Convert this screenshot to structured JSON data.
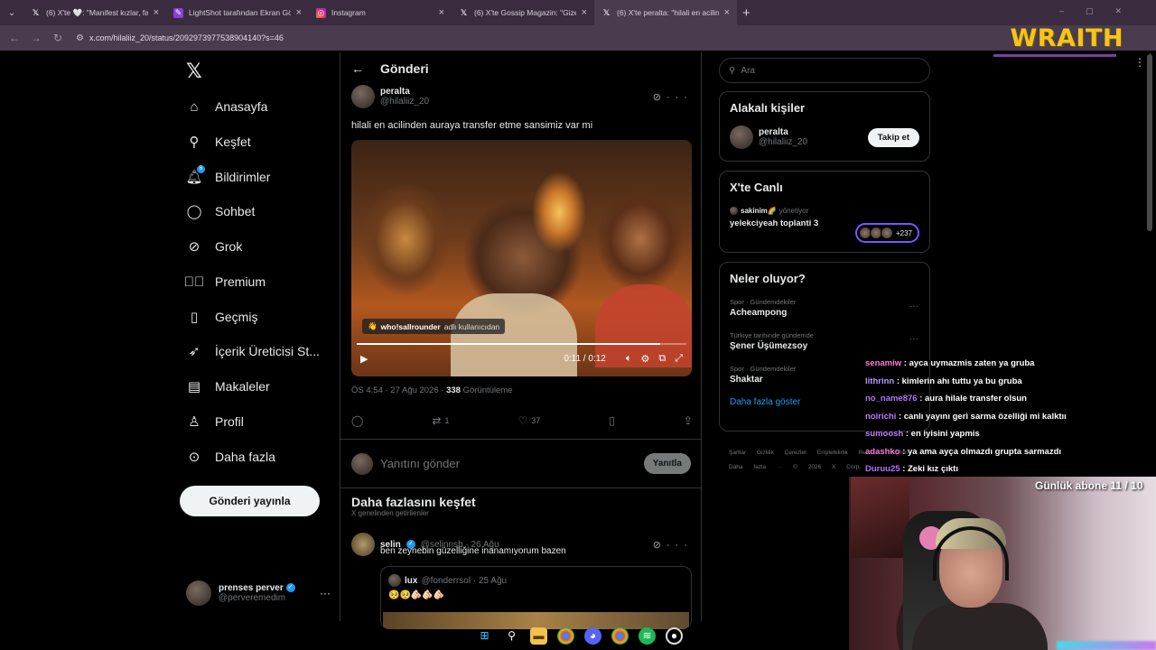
{
  "browser": {
    "tabs": [
      {
        "title": "(6) X'te 🤍: \"Manifest kızlar, fan",
        "favicon": "x-icon",
        "active": false
      },
      {
        "title": "LightShot tarafından Ekran Gör",
        "favicon": "lightshot-icon",
        "active": false
      },
      {
        "title": "Instagram",
        "favicon": "instagram-icon",
        "active": false
      },
      {
        "title": "(6) X'te Gossip Magazin: \"Gizem",
        "favicon": "x-icon",
        "active": false
      },
      {
        "title": "(6) X'te peralta: \"hilali en acilind",
        "favicon": "x-icon",
        "active": true
      }
    ],
    "url": "x.com/hilaliiz_20/status/2092973977538904140?s=46"
  },
  "overlay_brand": "WRAITH",
  "nav": {
    "items": [
      {
        "label": "Anasayfa",
        "icon": "home-icon"
      },
      {
        "label": "Keşfet",
        "icon": "search-icon"
      },
      {
        "label": "Bildirimler",
        "icon": "bell-icon",
        "badge": "6"
      },
      {
        "label": "Sohbet",
        "icon": "chat-icon"
      },
      {
        "label": "Grok",
        "icon": "grok-icon"
      },
      {
        "label": "Premium",
        "icon": "premium-icon"
      },
      {
        "label": "Geçmiş",
        "icon": "bookmark-icon"
      },
      {
        "label": "İçerik Üreticisi St...",
        "icon": "rocket-icon"
      },
      {
        "label": "Makaleler",
        "icon": "article-icon"
      },
      {
        "label": "Profil",
        "icon": "person-icon"
      },
      {
        "label": "Daha fazla",
        "icon": "more-icon"
      }
    ],
    "post_button": "Gönderi yayınla",
    "me": {
      "name": "prenses perver",
      "handle": "@perveremedim"
    }
  },
  "main": {
    "header": "Gönderi",
    "tweet": {
      "name": "peralta",
      "handle": "@hilaliiz_20",
      "text": "hilali en acilinden auraya transfer etme sansimiz var mi",
      "video_caption_user": "who!sallrounder",
      "video_caption_sub": "adlı kullanıcıdan",
      "video_time": "0:11 / 0:12",
      "video_progress": 0.92,
      "timestamp": "ÖS 4:54 · 27 Ağu 2026 · ",
      "views": "338",
      "views_label": "Görüntüleme",
      "retweets": "1",
      "likes": "37"
    },
    "reply_placeholder": "Yanıtını gönder",
    "reply_button": "Yanıtla",
    "discover_title": "Daha fazlasını keşfet",
    "discover_sub": "X genelinden getirilenler",
    "tweet2": {
      "name": "selin",
      "handle": "@selinnsb · 26 Ağu",
      "text": "ben zeynebin güzelliğine inanamıyorum bazen",
      "quote_name": "lux",
      "quote_handle": "@fonderrsol · 25 Ağu",
      "quote_text": "🥺🥺🫵🏻🫵🏻🫵🏻"
    }
  },
  "right": {
    "search_placeholder": "Ara",
    "related_title": "Alakalı kişiler",
    "related": {
      "name": "peralta",
      "handle": "@hilaliiz_20",
      "button": "Takip et"
    },
    "live_title": "X'te Canlı",
    "live_host": "sakinim🌈",
    "live_host_suffix": "yönetiyor",
    "live_name": "yelekciyeah toplanti 3",
    "live_count": "+237",
    "trends_title": "Neler oluyor?",
    "trends": [
      {
        "category": "Spor · Gündemdekiler",
        "topic": "Acheampong"
      },
      {
        "category": "Türkiye tarihinde gündemde",
        "topic": "Şener Üşümezsoy"
      },
      {
        "category": "Spor · Gündemdekiler",
        "topic": "Shaktar"
      }
    ],
    "show_more": "Daha fazla göster",
    "footer": "Şartlar Gizlilik Çerezler Erişilebilirlik Reklam Bilgileri Daha fazla ··· © 2026 X Corp."
  },
  "chat": [
    {
      "user": "senamiw",
      "text": ": ayca uymazmis zaten ya gruba",
      "color": "#ff7ad9"
    },
    {
      "user": "lithrinn",
      "text": ": kimlerin ahı tuttu ya bu gruba",
      "color": "#b39dff"
    },
    {
      "user": "no_name876",
      "text": ": aura hilale transfer olsun",
      "color": "#b072ff"
    },
    {
      "user": "noirichi",
      "text": ": canlı yayını geri sarma özelliği mi kalktıı",
      "color": "#c07cff"
    },
    {
      "user": "sumoosh",
      "text": ": en iyisini yapmis",
      "color": "#c07cff"
    },
    {
      "user": "adashko",
      "text": ": ya ama ayça olmazdı grupta sarmazdı",
      "color": "#ff7ad9"
    },
    {
      "user": "Duruu25",
      "text": ": Zeki kız çıktı",
      "color": "#b072ff"
    }
  ],
  "sub_goal": "Günlük abone 11 / 10"
}
